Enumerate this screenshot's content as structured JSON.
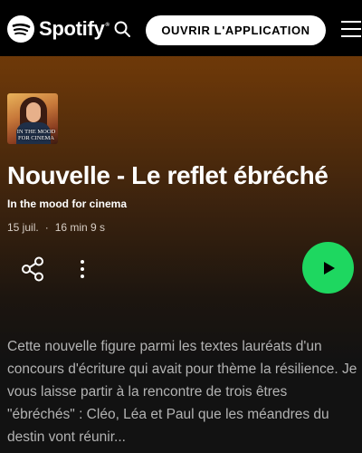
{
  "header": {
    "logo_text": "Spotify",
    "logo_tm": "®",
    "open_app_label": "OUVRIR L'APPLICATION"
  },
  "episode": {
    "cover_title": "IN THE MOOD FOR CINEMA",
    "title": "Nouvelle - Le reflet ébréché",
    "show_name": "In the mood for cinema",
    "date": "15 juil.",
    "separator": "·",
    "duration": "16 min 9 s",
    "description": "Cette nouvelle figure parmi les textes lauréats d'un concours d'écriture qui avait pour thème la résilience. Je vous laisse partir à la rencontre de trois êtres \"ébréchés\" : Cléo, Léa et Paul que les méandres du destin vont réunir..."
  },
  "icons": {
    "logo": "spotify-logo-icon",
    "search": "search-icon",
    "menu": "hamburger-menu-icon",
    "share": "share-icon",
    "more": "more-options-icon",
    "play": "play-icon"
  },
  "colors": {
    "accent_green": "#1ed760",
    "header_bg": "#000000",
    "gradient_top": "#7a3f07",
    "page_bg": "#121212",
    "description_text": "#b3b3b3"
  }
}
